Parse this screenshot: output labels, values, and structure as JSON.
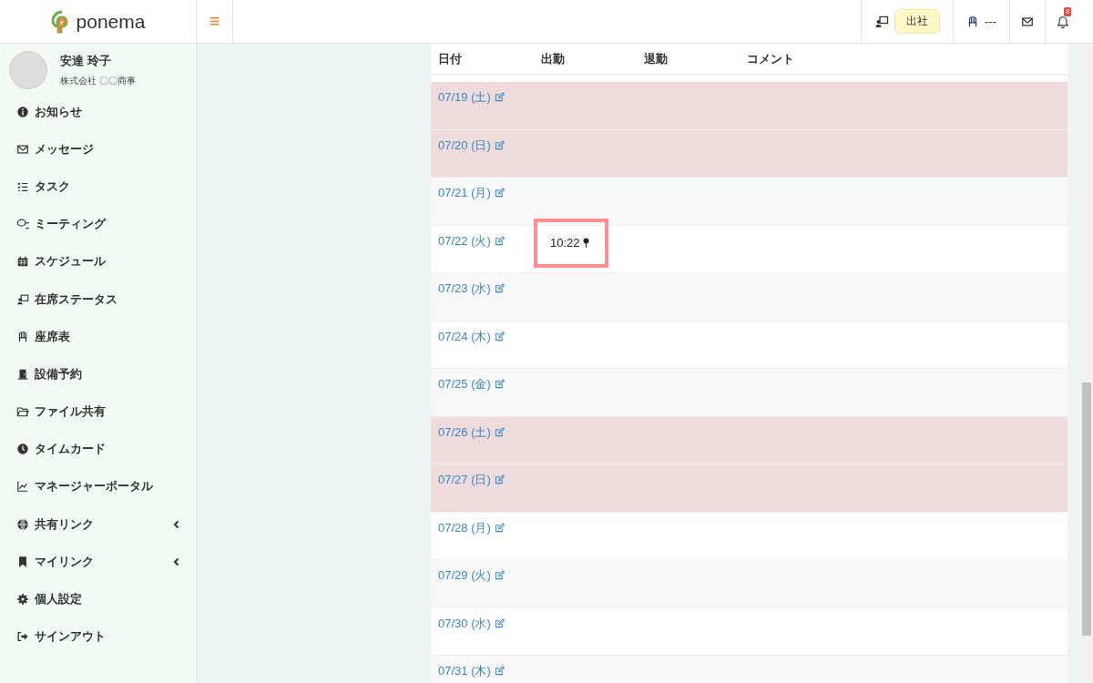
{
  "header": {
    "logo": "ponema",
    "menu_toggle": "≡",
    "status": "出社",
    "seat": "---",
    "notification_count": "8"
  },
  "user": {
    "name": "安達 玲子",
    "company": "株式会社 〇〇商事"
  },
  "sidebar": {
    "items": [
      {
        "label": "お知らせ",
        "expandable": false
      },
      {
        "label": "メッセージ",
        "expandable": false
      },
      {
        "label": "タスク",
        "expandable": false
      },
      {
        "label": "ミーティング",
        "expandable": false
      },
      {
        "label": "スケジュール",
        "expandable": false
      },
      {
        "label": "在席ステータス",
        "expandable": false
      },
      {
        "label": "座席表",
        "expandable": false
      },
      {
        "label": "設備予約",
        "expandable": false
      },
      {
        "label": "ファイル共有",
        "expandable": false
      },
      {
        "label": "タイムカード",
        "expandable": false
      },
      {
        "label": "マネージャーポータル",
        "expandable": false
      },
      {
        "label": "共有リンク",
        "expandable": true
      },
      {
        "label": "マイリンク",
        "expandable": true
      },
      {
        "label": "個人設定",
        "expandable": false
      },
      {
        "label": "サインアウト",
        "expandable": false
      }
    ]
  },
  "table": {
    "columns": [
      "日付",
      "出勤",
      "退勤",
      "コメント"
    ],
    "rows": [
      {
        "date": "07/19 (土)",
        "holiday": true,
        "clock_in": "",
        "highlighted": false
      },
      {
        "date": "07/20 (日)",
        "holiday": true,
        "clock_in": "",
        "highlighted": false
      },
      {
        "date": "07/21 (月)",
        "holiday": false,
        "clock_in": "",
        "highlighted": false
      },
      {
        "date": "07/22 (火)",
        "holiday": false,
        "clock_in": "10:22",
        "highlighted": true
      },
      {
        "date": "07/23 (水)",
        "holiday": false,
        "clock_in": "",
        "highlighted": false
      },
      {
        "date": "07/24 (木)",
        "holiday": false,
        "clock_in": "",
        "highlighted": false
      },
      {
        "date": "07/25 (金)",
        "holiday": false,
        "clock_in": "",
        "highlighted": false
      },
      {
        "date": "07/26 (土)",
        "holiday": true,
        "clock_in": "",
        "highlighted": false
      },
      {
        "date": "07/27 (日)",
        "holiday": true,
        "clock_in": "",
        "highlighted": false
      },
      {
        "date": "07/28 (月)",
        "holiday": false,
        "clock_in": "",
        "highlighted": false
      },
      {
        "date": "07/29 (火)",
        "holiday": false,
        "clock_in": "",
        "highlighted": false
      },
      {
        "date": "07/30 (水)",
        "holiday": false,
        "clock_in": "",
        "highlighted": false
      },
      {
        "date": "07/31 (木)",
        "holiday": false,
        "clock_in": "",
        "highlighted": false
      }
    ]
  }
}
